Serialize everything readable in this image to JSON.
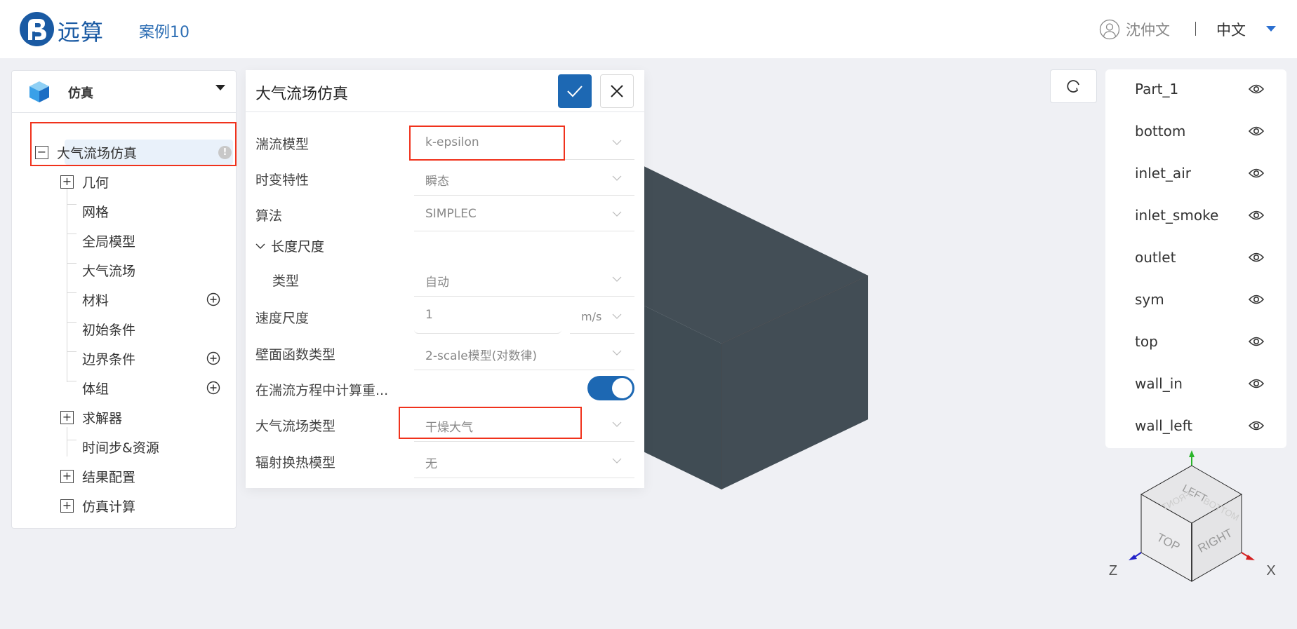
{
  "header": {
    "logo_text": "远算",
    "case_title": "案例10",
    "user_name": "沈仲文",
    "language": "中文",
    "brand_color": "#1a5aa3"
  },
  "sidebar": {
    "title": "仿真",
    "tree": {
      "root": {
        "label": "大气流场仿真",
        "expanded": true,
        "status": "warning",
        "status_glyph": "!"
      },
      "items": [
        {
          "label": "几何",
          "expander": "+"
        },
        {
          "label": "网格"
        },
        {
          "label": "全局模型"
        },
        {
          "label": "大气流场"
        },
        {
          "label": "材料",
          "add": true
        },
        {
          "label": "初始条件"
        },
        {
          "label": "边界条件",
          "add": true
        },
        {
          "label": "体组",
          "add": true
        },
        {
          "label": "求解器",
          "expander": "+"
        },
        {
          "label": "时间步&资源"
        },
        {
          "label": "结果配置",
          "expander": "+"
        },
        {
          "label": "仿真计算",
          "expander": "+"
        }
      ]
    }
  },
  "form": {
    "title": "大气流场仿真",
    "confirm_label": "确认",
    "close_label": "关闭",
    "fields": {
      "turbulence_model": {
        "label": "湍流模型",
        "value": "k-epsilon"
      },
      "time_dependence": {
        "label": "时变特性",
        "value": "瞬态"
      },
      "algorithm": {
        "label": "算法",
        "value": "SIMPLEC"
      },
      "length_scale_section": {
        "label": "长度尺度",
        "expanded": true
      },
      "length_scale_type": {
        "label": "类型",
        "value": "自动"
      },
      "velocity_scale": {
        "label": "速度尺度",
        "value": "1",
        "unit": "m/s"
      },
      "wall_function": {
        "label": "壁面函数类型",
        "value": "2-scale模型(对数律)"
      },
      "gravity_in_turbulence": {
        "label": "在湍流方程中计算重...",
        "enabled": true
      },
      "atmosphere_type": {
        "label": "大气流场类型",
        "value": "干燥大气"
      },
      "radiation_model": {
        "label": "辐射换热模型",
        "value": "无"
      }
    },
    "toggle_color": "#1d68b3"
  },
  "viewer": {
    "model_color": "#414d55",
    "parts": [
      {
        "name": "Part_1",
        "visible": true
      },
      {
        "name": "bottom",
        "visible": true
      },
      {
        "name": "inlet_air",
        "visible": true
      },
      {
        "name": "inlet_smoke",
        "visible": true
      },
      {
        "name": "outlet",
        "visible": true
      },
      {
        "name": "sym",
        "visible": true
      },
      {
        "name": "top",
        "visible": true
      },
      {
        "name": "wall_in",
        "visible": true
      },
      {
        "name": "wall_left",
        "visible": true
      }
    ],
    "view_cube": {
      "faces": [
        "TOP",
        "RIGHT",
        "LEFT",
        "FRONT",
        "BOTTOM"
      ],
      "axis_labels": {
        "z": "Z",
        "x": "X"
      },
      "axis_colors": {
        "x": "#d42020",
        "y": "#2bb52b",
        "z": "#2020c8"
      }
    }
  },
  "annotations": {
    "highlight_color": "#f0321c"
  }
}
